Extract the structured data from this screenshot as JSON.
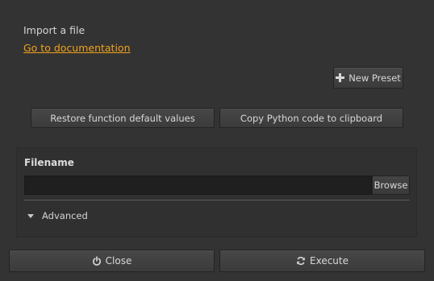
{
  "header": {
    "title": "Import a file",
    "doc_link": "Go to documentation"
  },
  "toolbar": {
    "new_preset_label": "New Preset",
    "new_preset_icon": "plus-icon"
  },
  "actions": {
    "restore_label": "Restore function default values",
    "copy_label": "Copy Python code to clipboard"
  },
  "form": {
    "filename_label": "Filename",
    "filename_value": "",
    "filename_placeholder": "",
    "browse_label": "Browse",
    "advanced_label": "Advanced",
    "advanced_icon": "triangle-down-icon"
  },
  "footer": {
    "close_label": "Close",
    "close_icon": "power-icon",
    "execute_label": "Execute",
    "execute_icon": "refresh-icon"
  },
  "colors": {
    "background": "#333333",
    "link": "#f0a11c",
    "input_bg": "#1f1f1f"
  }
}
